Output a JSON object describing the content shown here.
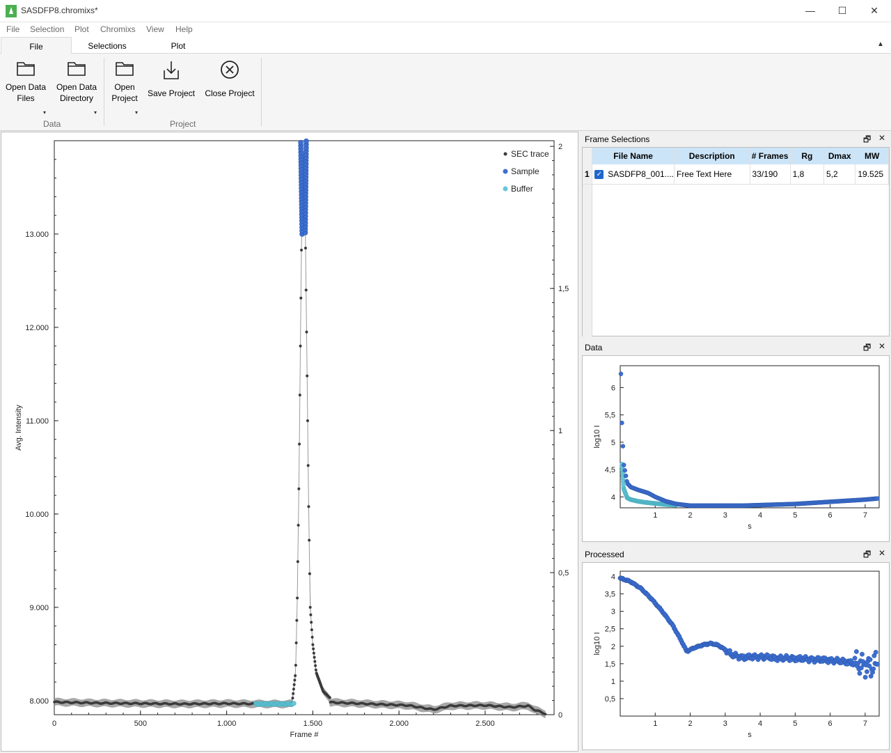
{
  "window": {
    "title": "SASDFP8.chromixs*",
    "minimize": "—",
    "maximize": "☐",
    "close": "✕"
  },
  "menu": [
    "File",
    "Selection",
    "Plot",
    "Chromixs",
    "View",
    "Help"
  ],
  "ribbon_tabs": [
    "File",
    "Selections",
    "Plot"
  ],
  "ribbon_collapse": "▲",
  "ribbon": {
    "open_data_files": [
      "Open Data",
      "Files"
    ],
    "open_data_directory": [
      "Open Data",
      "Directory"
    ],
    "open_project": [
      "Open",
      "Project"
    ],
    "save_project": "Save Project",
    "close_project": "Close Project",
    "group_data": "Data",
    "group_project": "Project",
    "dropdown_glyph": "▾"
  },
  "main_chart": {
    "chart_data": {
      "type": "scatter",
      "xlabel": "Frame #",
      "ylabel": "Avg. Intensity",
      "xlim": [
        0,
        2900
      ],
      "ylim": [
        7850,
        14000
      ],
      "y2lim": [
        0,
        2.02
      ],
      "x_ticks": [
        0,
        500,
        1000,
        1500,
        2000,
        2500
      ],
      "x_tick_labels": [
        "0",
        "500",
        "1.000",
        "1.500",
        "2.000",
        "2.500"
      ],
      "y_ticks": [
        8000,
        9000,
        10000,
        11000,
        12000,
        13000
      ],
      "y_tick_labels": [
        "8.000",
        "9.000",
        "10.000",
        "11.000",
        "12.000",
        "13.000"
      ],
      "y2_ticks": [
        0,
        0.5,
        1,
        1.5,
        2
      ],
      "y2_tick_labels": [
        "0",
        "0,5",
        "1",
        "1,5",
        "2"
      ],
      "legend": [
        "SEC trace",
        "Sample",
        "Buffer"
      ],
      "legend_position": "top-right",
      "series": [
        {
          "name": "SEC trace",
          "color": "#3a3a3a",
          "band_color": "#8a8a8a",
          "baseline": [
            [
              0,
              7985
            ],
            [
              250,
              7975
            ],
            [
              500,
              7970
            ],
            [
              750,
              7965
            ],
            [
              1000,
              7970
            ],
            [
              1200,
              7965
            ],
            [
              1380,
              7965
            ],
            [
              1500,
              7990
            ],
            [
              1700,
              7975
            ],
            [
              1900,
              7960
            ],
            [
              2050,
              7950
            ],
            [
              2200,
              7905
            ],
            [
              2300,
              7945
            ],
            [
              2500,
              7950
            ],
            [
              2650,
              7930
            ],
            [
              2750,
              7945
            ],
            [
              2790,
              7900
            ],
            [
              2850,
              7860
            ]
          ],
          "peak": [
            [
              1380,
              7980
            ],
            [
              1400,
              8300
            ],
            [
              1410,
              9100
            ],
            [
              1420,
              10400
            ],
            [
              1428,
              11800
            ],
            [
              1435,
              13000
            ],
            [
              1445,
              13950
            ],
            [
              1455,
              13300
            ],
            [
              1465,
              11800
            ],
            [
              1475,
              10200
            ],
            [
              1485,
              9000
            ],
            [
              1500,
              8600
            ],
            [
              1520,
              8300
            ],
            [
              1560,
              8100
            ],
            [
              1600,
              8030
            ]
          ]
        },
        {
          "name": "Sample",
          "color": "#3d6fd1",
          "x_range": [
            1430,
            1462
          ],
          "y_range": [
            13000,
            14000
          ]
        },
        {
          "name": "Buffer",
          "color": "#67c7d6",
          "x_range": [
            1170,
            1390
          ],
          "y": 7965
        }
      ]
    }
  },
  "frame_selections": {
    "title": "Frame Selections",
    "float_icon": "🗗",
    "close_icon": "✕",
    "columns": [
      "File Name",
      "Description",
      "# Frames",
      "Rg",
      "Dmax",
      "MW"
    ],
    "rows": [
      {
        "index": "1",
        "file_name": "SASDFP8_001....",
        "description": "Free Text Here",
        "frames": "33/190",
        "rg": "1,8",
        "dmax": "5,2",
        "mw": "19.525"
      }
    ]
  },
  "data_panel": {
    "title": "Data",
    "chart_data": {
      "type": "scatter",
      "xlabel": "s",
      "ylabel": "log10 I",
      "xlim": [
        0,
        7.4
      ],
      "ylim": [
        3.8,
        6.4
      ],
      "x_ticks": [
        1,
        2,
        3,
        4,
        5,
        6,
        7
      ],
      "x_tick_labels": [
        "1",
        "2",
        "3",
        "4",
        "5",
        "6",
        "7"
      ],
      "y_ticks": [
        4,
        4.5,
        5,
        5.5,
        6
      ],
      "y_tick_labels": [
        "4",
        "4,5",
        "5",
        "5,5",
        "6"
      ],
      "series": [
        {
          "name": "Sample",
          "color": "#3d6fd1",
          "x": [
            0.02,
            0.05,
            0.1,
            0.2,
            0.3,
            0.5,
            0.8,
            1.0,
            1.3,
            1.6,
            2.0,
            2.5,
            3.0,
            3.5,
            4.0,
            4.5,
            5.0,
            5.5,
            6.0,
            6.5,
            7.0,
            7.35
          ],
          "y": [
            6.25,
            5.3,
            4.6,
            4.25,
            4.18,
            4.13,
            4.07,
            4.0,
            3.92,
            3.87,
            3.84,
            3.84,
            3.84,
            3.84,
            3.85,
            3.86,
            3.87,
            3.89,
            3.91,
            3.93,
            3.95,
            3.97
          ]
        },
        {
          "name": "Buffer",
          "color": "#67c7d6",
          "x": [
            0.05,
            0.1,
            0.2,
            0.3,
            0.5,
            0.7,
            1.0,
            1.3,
            1.6
          ],
          "y": [
            4.6,
            4.15,
            3.98,
            3.95,
            3.92,
            3.9,
            3.88,
            3.86,
            3.85
          ]
        }
      ]
    }
  },
  "processed_panel": {
    "title": "Processed",
    "chart_data": {
      "type": "scatter",
      "xlabel": "s",
      "ylabel": "log10 I",
      "xlim": [
        0,
        7.4
      ],
      "ylim": [
        0,
        4.15
      ],
      "x_ticks": [
        1,
        2,
        3,
        4,
        5,
        6,
        7
      ],
      "x_tick_labels": [
        "1",
        "2",
        "3",
        "4",
        "5",
        "6",
        "7"
      ],
      "y_ticks": [
        0.5,
        1,
        1.5,
        2,
        2.5,
        3,
        3.5,
        4
      ],
      "y_tick_labels": [
        "0,5",
        "1",
        "1,5",
        "2",
        "2,5",
        "3",
        "3,5",
        "4"
      ],
      "series": [
        {
          "name": "Sample",
          "color": "#3d6fd1",
          "x": [
            0.0,
            0.3,
            0.6,
            0.9,
            1.2,
            1.5,
            1.75,
            1.9,
            2.1,
            2.4,
            2.6,
            2.8,
            3.0,
            3.2,
            3.5,
            4.0,
            4.5,
            5.0,
            5.5,
            6.0,
            6.5,
            6.8,
            7.0,
            7.2,
            7.35
          ],
          "y": [
            3.95,
            3.85,
            3.65,
            3.35,
            3.0,
            2.6,
            2.15,
            1.85,
            1.95,
            2.05,
            2.08,
            2.03,
            1.9,
            1.75,
            1.68,
            1.7,
            1.66,
            1.65,
            1.62,
            1.6,
            1.55,
            1.5,
            1.45,
            1.4,
            1.6
          ]
        }
      ]
    }
  },
  "colors": {
    "sample": "#3d6fd1",
    "buffer": "#67c7d6",
    "sec": "#3a3a3a",
    "header": "#cce4f7",
    "checkbox": "#2167c9"
  }
}
